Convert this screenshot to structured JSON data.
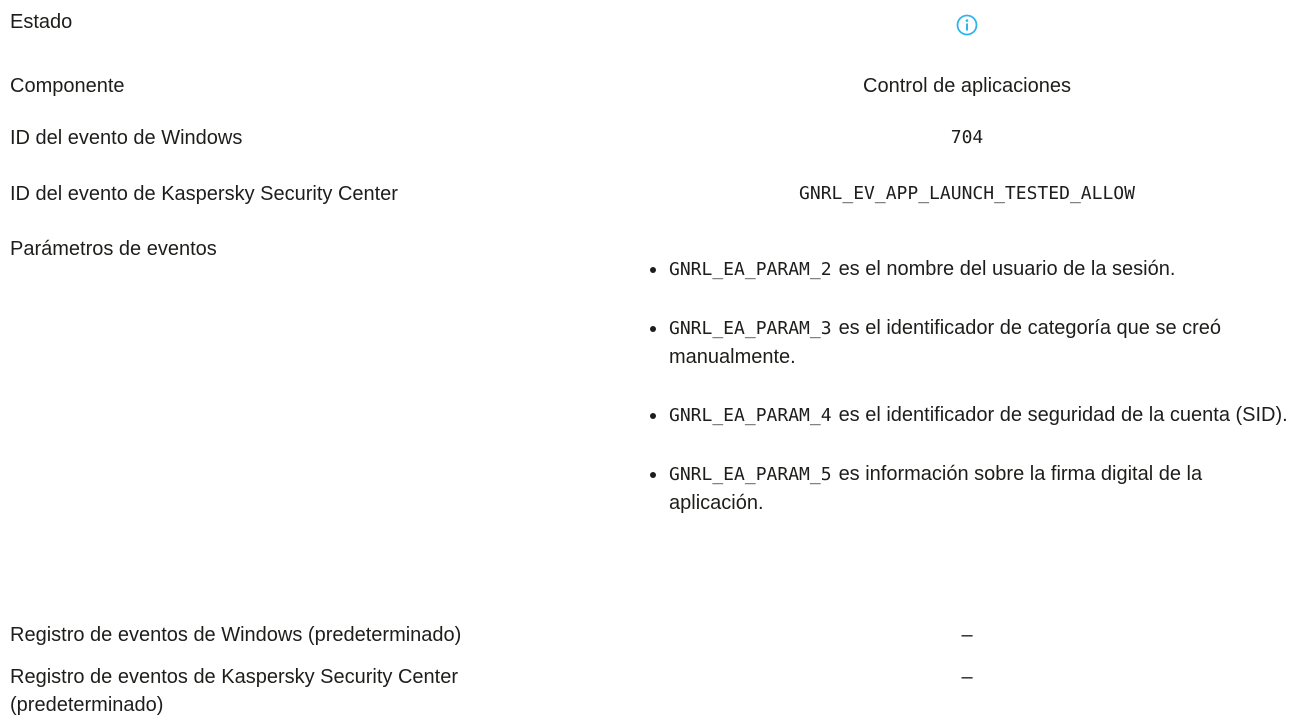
{
  "rows": {
    "estado": {
      "label": "Estado",
      "icon": "info-icon",
      "icon_color": "#2eb4f0"
    },
    "componente": {
      "label": "Componente",
      "value": "Control de aplicaciones"
    },
    "windows_event_id": {
      "label": "ID del evento de Windows",
      "value": "704"
    },
    "ksc_event_id": {
      "label": "ID del evento de Kaspersky Security Center",
      "value": "GNRL_EV_APP_LAUNCH_TESTED_ALLOW"
    },
    "event_params": {
      "label": "Parámetros de eventos",
      "items": [
        {
          "code": "GNRL_EA_PARAM_2",
          "text": "es el nombre del usuario de la sesión."
        },
        {
          "code": "GNRL_EA_PARAM_3",
          "text": "es el identificador de categoría que se creó manualmente."
        },
        {
          "code": "GNRL_EA_PARAM_4",
          "text": "es el identificador de seguridad de la cuenta (SID)."
        },
        {
          "code": "GNRL_EA_PARAM_5",
          "text": "es información sobre la firma digital de la aplicación."
        }
      ]
    },
    "windows_log": {
      "label": "Registro de eventos de Windows (predeterminado)",
      "value": "–"
    },
    "ksc_log": {
      "label": "Registro de eventos de Kaspersky Security Center (predeterminado)",
      "value": "–"
    }
  }
}
